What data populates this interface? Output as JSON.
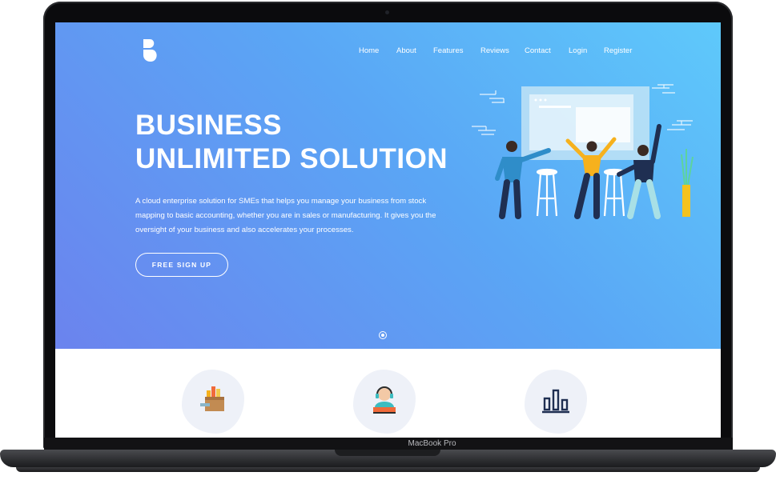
{
  "nav": {
    "logo_letter": "B",
    "items": [
      "Home",
      "About",
      "Features",
      "Reviews",
      "Contact",
      "Login",
      "Register"
    ]
  },
  "hero": {
    "title_line1": "BUSINESS",
    "title_line2": "UNLIMITED SOLUTION",
    "description": "A cloud enterprise solution for SMEs that helps you manage your business from stock mapping to basic accounting, whether you are in sales or manufacturing. It gives you the oversight of your business and also accelerates your processes.",
    "cta_label": "FREE SIGN UP"
  },
  "device": {
    "brand_label": "MacBook Pro"
  },
  "features": {
    "icons": [
      "inventory-boxes-icon",
      "support-agent-icon",
      "bar-chart-icon"
    ]
  },
  "colors": {
    "hero_gradient_start": "#5ec9fb",
    "hero_gradient_end": "#6b83ee",
    "blob_bg": "#eef1f8"
  }
}
